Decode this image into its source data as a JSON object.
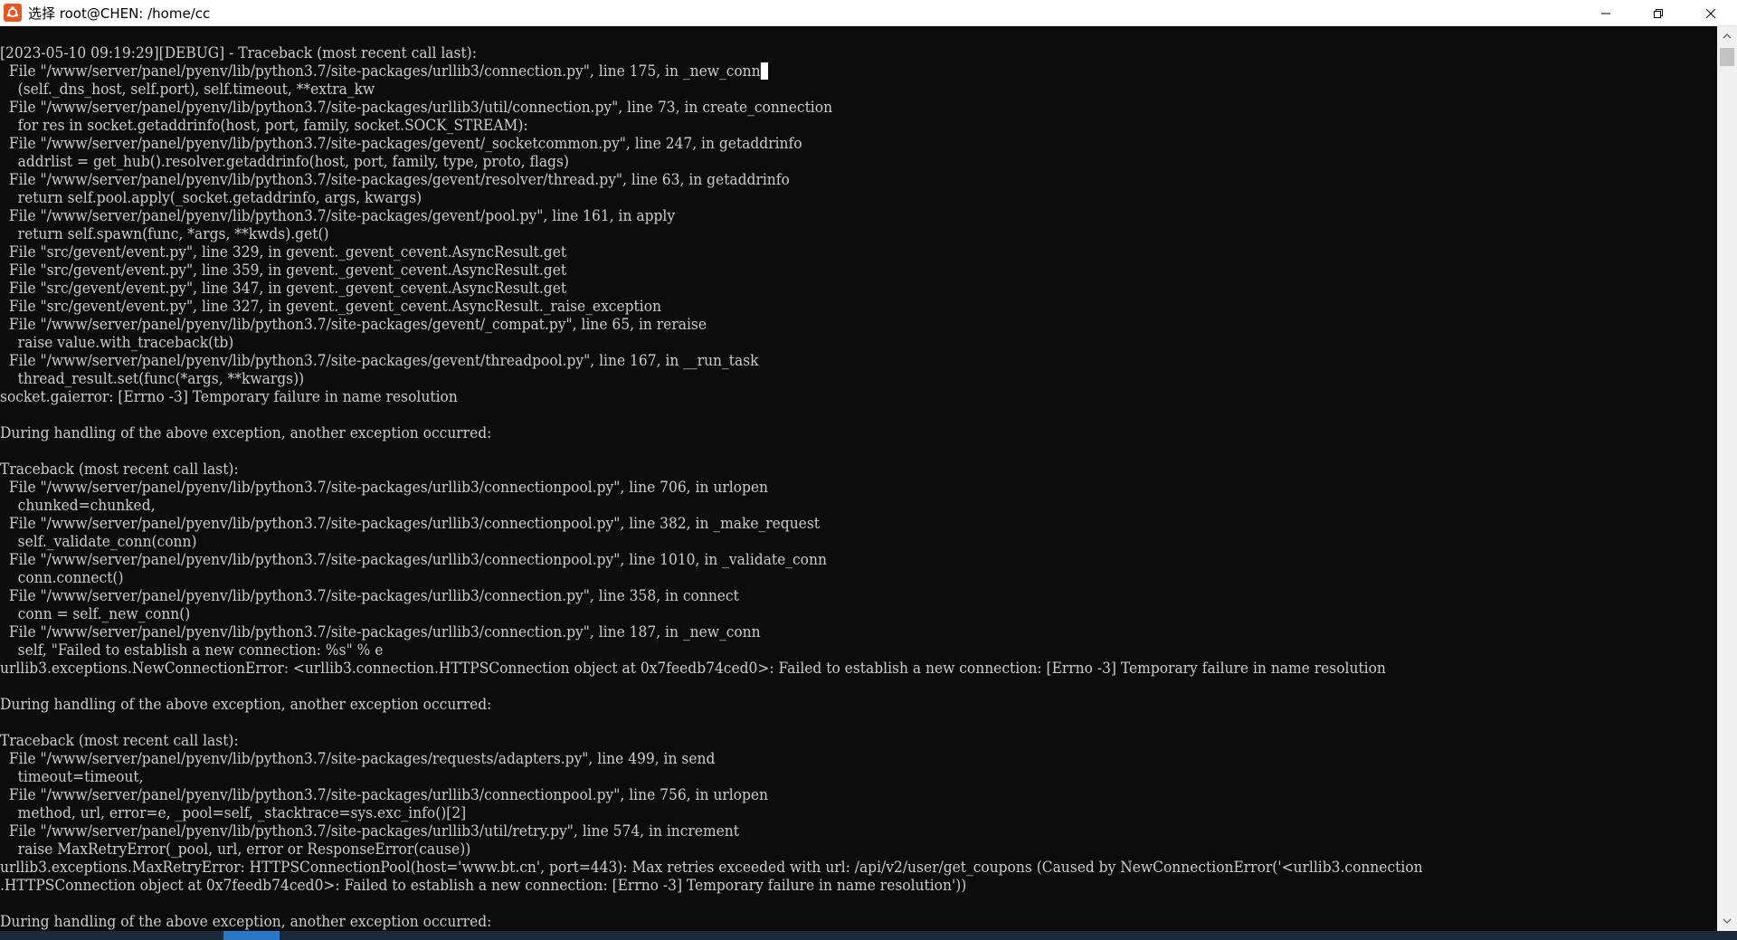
{
  "window": {
    "title": "选择 root@CHEN: /home/cc"
  },
  "terminal": {
    "lines": [
      "[2023-05-10 09:19:29][DEBUG] - Traceback (most recent call last):",
      "  File \"/www/server/panel/pyenv/lib/python3.7/site-packages/urllib3/connection.py\", line 175, in _new_conn",
      "    (self._dns_host, self.port), self.timeout, **extra_kw",
      "  File \"/www/server/panel/pyenv/lib/python3.7/site-packages/urllib3/util/connection.py\", line 73, in create_connection",
      "    for res in socket.getaddrinfo(host, port, family, socket.SOCK_STREAM):",
      "  File \"/www/server/panel/pyenv/lib/python3.7/site-packages/gevent/_socketcommon.py\", line 247, in getaddrinfo",
      "    addrlist = get_hub().resolver.getaddrinfo(host, port, family, type, proto, flags)",
      "  File \"/www/server/panel/pyenv/lib/python3.7/site-packages/gevent/resolver/thread.py\", line 63, in getaddrinfo",
      "    return self.pool.apply(_socket.getaddrinfo, args, kwargs)",
      "  File \"/www/server/panel/pyenv/lib/python3.7/site-packages/gevent/pool.py\", line 161, in apply",
      "    return self.spawn(func, *args, **kwds).get()",
      "  File \"src/gevent/event.py\", line 329, in gevent._gevent_cevent.AsyncResult.get",
      "  File \"src/gevent/event.py\", line 359, in gevent._gevent_cevent.AsyncResult.get",
      "  File \"src/gevent/event.py\", line 347, in gevent._gevent_cevent.AsyncResult.get",
      "  File \"src/gevent/event.py\", line 327, in gevent._gevent_cevent.AsyncResult._raise_exception",
      "  File \"/www/server/panel/pyenv/lib/python3.7/site-packages/gevent/_compat.py\", line 65, in reraise",
      "    raise value.with_traceback(tb)",
      "  File \"/www/server/panel/pyenv/lib/python3.7/site-packages/gevent/threadpool.py\", line 167, in __run_task",
      "    thread_result.set(func(*args, **kwargs))",
      "socket.gaierror: [Errno -3] Temporary failure in name resolution",
      "",
      "During handling of the above exception, another exception occurred:",
      "",
      "Traceback (most recent call last):",
      "  File \"/www/server/panel/pyenv/lib/python3.7/site-packages/urllib3/connectionpool.py\", line 706, in urlopen",
      "    chunked=chunked,",
      "  File \"/www/server/panel/pyenv/lib/python3.7/site-packages/urllib3/connectionpool.py\", line 382, in _make_request",
      "    self._validate_conn(conn)",
      "  File \"/www/server/panel/pyenv/lib/python3.7/site-packages/urllib3/connectionpool.py\", line 1010, in _validate_conn",
      "    conn.connect()",
      "  File \"/www/server/panel/pyenv/lib/python3.7/site-packages/urllib3/connection.py\", line 358, in connect",
      "    conn = self._new_conn()",
      "  File \"/www/server/panel/pyenv/lib/python3.7/site-packages/urllib3/connection.py\", line 187, in _new_conn",
      "    self, \"Failed to establish a new connection: %s\" % e",
      "urllib3.exceptions.NewConnectionError: <urllib3.connection.HTTPSConnection object at 0x7feedb74ced0>: Failed to establish a new connection: [Errno -3] Temporary failure in name resolution",
      "",
      "During handling of the above exception, another exception occurred:",
      "",
      "Traceback (most recent call last):",
      "  File \"/www/server/panel/pyenv/lib/python3.7/site-packages/requests/adapters.py\", line 499, in send",
      "    timeout=timeout,",
      "  File \"/www/server/panel/pyenv/lib/python3.7/site-packages/urllib3/connectionpool.py\", line 756, in urlopen",
      "    method, url, error=e, _pool=self, _stacktrace=sys.exc_info()[2]",
      "  File \"/www/server/panel/pyenv/lib/python3.7/site-packages/urllib3/util/retry.py\", line 574, in increment",
      "    raise MaxRetryError(_pool, url, error or ResponseError(cause))",
      "urllib3.exceptions.MaxRetryError: HTTPSConnectionPool(host='www.bt.cn', port=443): Max retries exceeded with url: /api/v2/user/get_coupons (Caused by NewConnectionError('<urllib3.connection",
      ".HTTPSConnection object at 0x7feedb74ced0>: Failed to establish a new connection: [Errno -3] Temporary failure in name resolution'))",
      "",
      "During handling of the above exception, another exception occurred:"
    ],
    "cursor_line": 1
  },
  "icons": {
    "app": "ubuntu-icon",
    "minimize": "minimize-icon",
    "maximize": "restore-icon",
    "close": "close-icon",
    "scroll_up": "scroll-up-arrow-icon",
    "scroll_down": "scroll-down-arrow-icon"
  },
  "colors": {
    "terminal_bg": "#0c0c0c",
    "terminal_fg": "#cccccc",
    "app_icon": "#e9541f"
  }
}
